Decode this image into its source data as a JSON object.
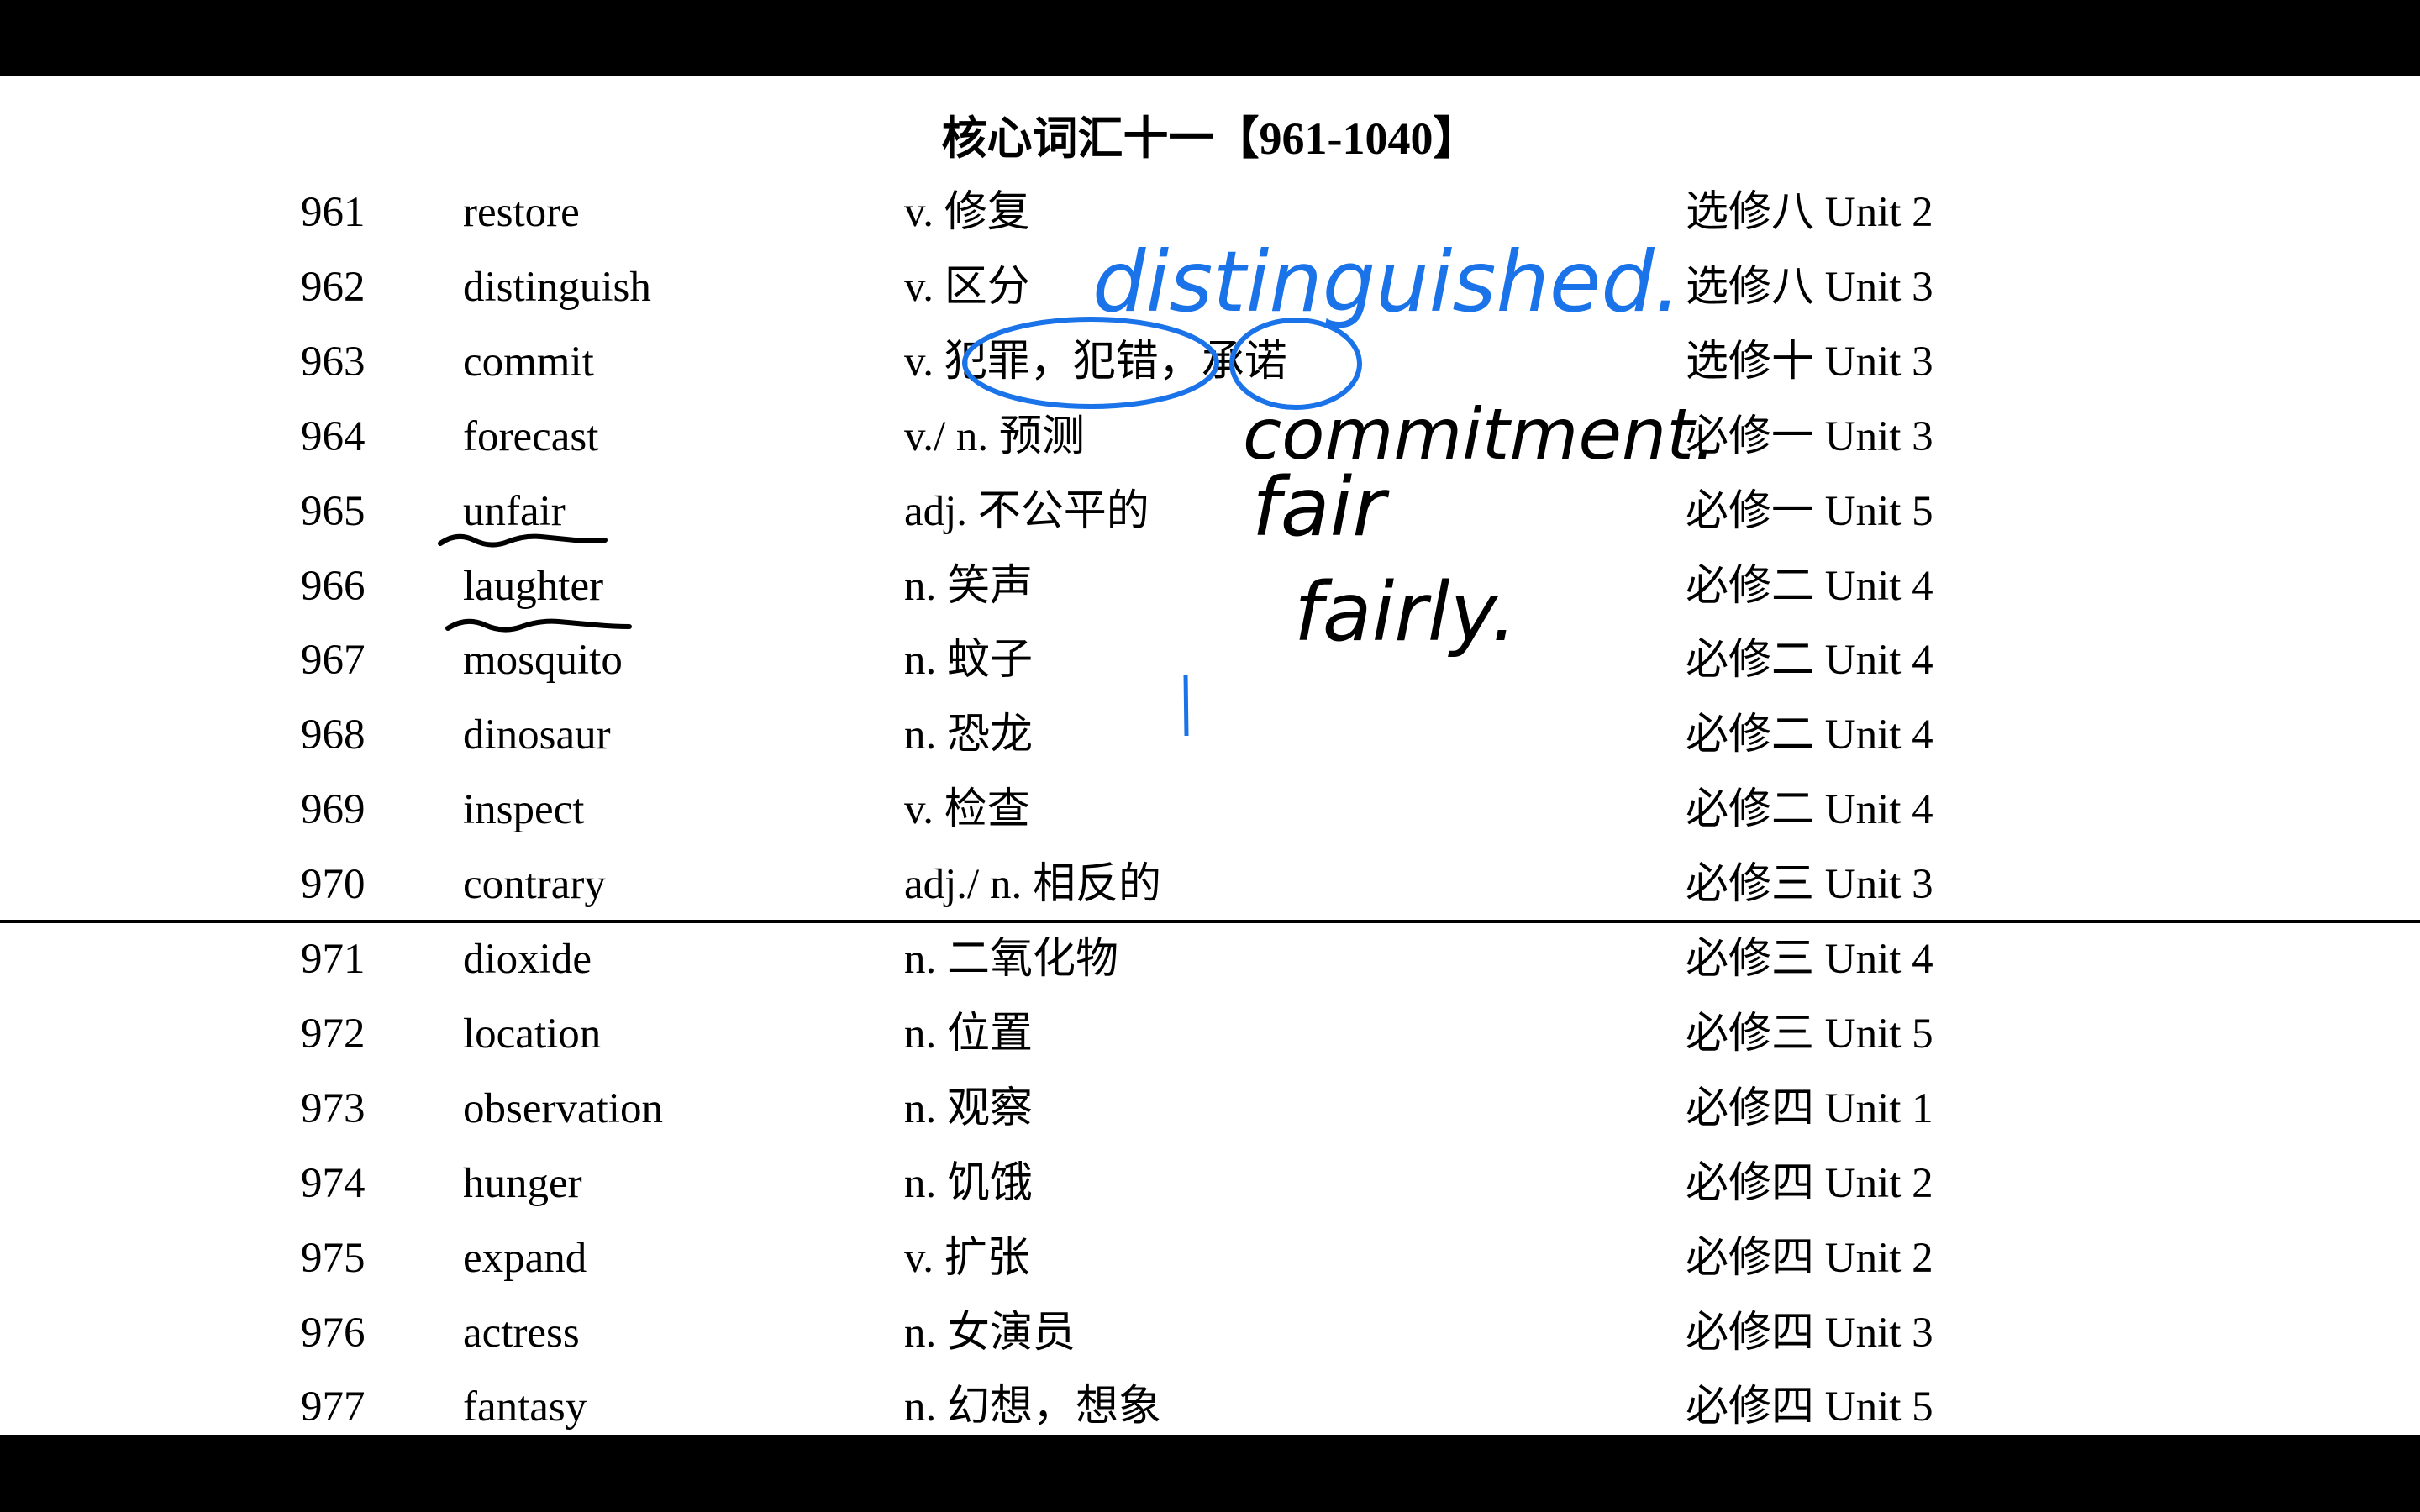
{
  "title": "核心词汇十一【961-1040】",
  "rows": [
    {
      "num": "961",
      "word": "restore",
      "def": "v. 修复",
      "unit": "选修八  Unit 2"
    },
    {
      "num": "962",
      "word": "distinguish",
      "def": "v. 区分",
      "unit": "选修八  Unit 3"
    },
    {
      "num": "963",
      "word": "commit",
      "def": "v. 犯罪，犯错，承诺",
      "unit": "选修十  Unit 3"
    },
    {
      "num": "964",
      "word": "forecast",
      "def": "v./ n. 预测",
      "unit": "必修一  Unit 3"
    },
    {
      "num": "965",
      "word": "unfair",
      "def": "adj. 不公平的",
      "unit": "必修一  Unit 5"
    },
    {
      "num": "966",
      "word": "laughter",
      "def": "n. 笑声",
      "unit": "必修二  Unit 4"
    },
    {
      "num": "967",
      "word": "mosquito",
      "def": "n. 蚊子",
      "unit": "必修二  Unit 4"
    },
    {
      "num": "968",
      "word": "dinosaur",
      "def": "n. 恐龙",
      "unit": "必修二  Unit 4"
    },
    {
      "num": "969",
      "word": "inspect",
      "def": "v. 检查",
      "unit": "必修二  Unit 4"
    },
    {
      "num": "970",
      "word": "contrary",
      "def": "adj./ n. 相反的",
      "unit": "必修三  Unit 3"
    },
    {
      "num": "971",
      "word": "dioxide",
      "def": "n. 二氧化物",
      "unit": "必修三  Unit 4"
    },
    {
      "num": "972",
      "word": "location",
      "def": "n. 位置",
      "unit": "必修三  Unit 5"
    },
    {
      "num": "973",
      "word": "observation",
      "def": "n. 观察",
      "unit": "必修四  Unit 1"
    },
    {
      "num": "974",
      "word": "hunger",
      "def": "n. 饥饿",
      "unit": "必修四  Unit 2"
    },
    {
      "num": "975",
      "word": "expand",
      "def": "v. 扩张",
      "unit": "必修四  Unit 2"
    },
    {
      "num": "976",
      "word": "actress",
      "def": "n. 女演员",
      "unit": "必修四  Unit 3"
    },
    {
      "num": "977",
      "word": "fantasy",
      "def": "n. 幻想，想象",
      "unit": "必修四  Unit 5"
    }
  ],
  "annotations": {
    "distinguished": "distinguished.",
    "commitment": "commitment.",
    "fair": "fair",
    "fairly": "fairly.",
    "blue_ink": "#1a73e8",
    "black_ink": "#000000"
  }
}
